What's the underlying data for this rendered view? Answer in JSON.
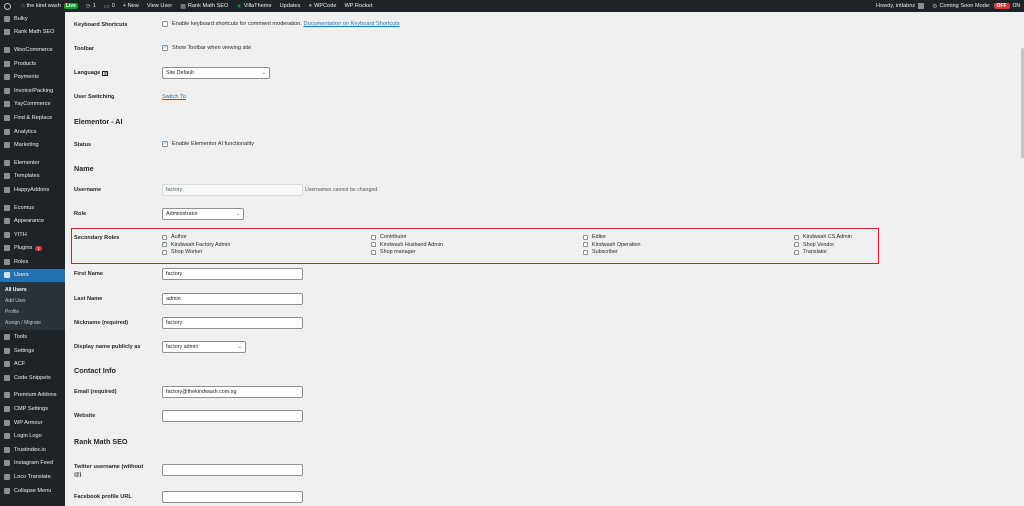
{
  "adminbar": {
    "site_name": "the kind wash",
    "live_label": "Live",
    "updates_count": "1",
    "comments_count": "0",
    "new_label": "+ New",
    "view_user_label": "View User",
    "items": [
      "Rank Math SEO",
      "VillaTheme",
      "Updates",
      "WPCode",
      "WP Rocket"
    ],
    "howdy": "Howdy, intlabnz",
    "coming_soon_label": "Coming Soon Mode:",
    "off_label": "OFF",
    "on_label": "ON"
  },
  "sidebar": {
    "items": [
      {
        "label": "Bulky",
        "icon": "bulky-icon"
      },
      {
        "label": "Rank Math SEO",
        "icon": "rank-math-icon"
      },
      {
        "label": "WooCommerce",
        "icon": "woocommerce-icon"
      },
      {
        "label": "Products",
        "icon": "products-icon"
      },
      {
        "label": "Payments",
        "icon": "payments-icon"
      },
      {
        "label": "Invoice/Packing",
        "icon": "invoice-icon"
      },
      {
        "label": "YayCommerce",
        "icon": "yaycommerce-icon"
      },
      {
        "label": "Find & Replace",
        "icon": "find-replace-icon"
      },
      {
        "label": "Analytics",
        "icon": "analytics-icon"
      },
      {
        "label": "Marketing",
        "icon": "marketing-icon"
      },
      {
        "label": "Elementor",
        "icon": "elementor-icon"
      },
      {
        "label": "Templates",
        "icon": "templates-icon"
      },
      {
        "label": "HappyAddons",
        "icon": "happyaddons-icon"
      },
      {
        "label": "Ecomus",
        "icon": "ecomus-icon"
      },
      {
        "label": "Appearance",
        "icon": "appearance-icon"
      },
      {
        "label": "YITH",
        "icon": "yith-icon"
      },
      {
        "label": "Plugins",
        "icon": "plugins-icon",
        "badge": "1"
      },
      {
        "label": "Roles",
        "icon": "roles-icon"
      },
      {
        "label": "Users",
        "icon": "users-icon"
      }
    ],
    "submenu": [
      "All Users",
      "Add User",
      "Profile",
      "Assign / Migrate"
    ],
    "items_after": [
      {
        "label": "Tools",
        "icon": "tools-icon"
      },
      {
        "label": "Settings",
        "icon": "settings-icon"
      },
      {
        "label": "ACF",
        "icon": "acf-icon"
      },
      {
        "label": "Code Snippets",
        "icon": "code-snippets-icon"
      },
      {
        "label": "Premium Addons",
        "icon": "premium-addons-icon"
      },
      {
        "label": "CMP Settings",
        "icon": "cmp-icon"
      },
      {
        "label": "WP Armour",
        "icon": "wp-armour-icon"
      },
      {
        "label": "Login Logo",
        "icon": "login-logo-icon"
      },
      {
        "label": "Trustindex.io",
        "icon": "trustindex-icon"
      },
      {
        "label": "Instagram Feed",
        "icon": "instagram-icon"
      },
      {
        "label": "Loco Translate",
        "icon": "loco-icon"
      },
      {
        "label": "Collapse Menu",
        "icon": "collapse-icon"
      }
    ]
  },
  "form": {
    "keyboard_label": "Keyboard Shortcuts",
    "keyboard_text": "Enable keyboard shortcuts for comment moderation.",
    "keyboard_link": "Documentation on Keyboard Shortcuts",
    "toolbar_label": "Toolbar",
    "toolbar_text": "Show Toolbar when viewing site",
    "language_label": "Language",
    "language_value": "Site Default",
    "user_switching_label": "User Switching",
    "switch_to": "Switch To",
    "elementor_ai_heading": "Elementor - AI",
    "status_label": "Status",
    "status_text": "Enable Elementor AI functionality",
    "name_heading": "Name",
    "username_label": "Username",
    "username_value": "factory",
    "username_desc": "Usernames cannot be changed.",
    "role_label": "Role",
    "role_value": "Administrator",
    "secondary_roles_label": "Secondary Roles",
    "secondary_roles": [
      {
        "label": "Author",
        "checked": false
      },
      {
        "label": "Kindwash Factory Admin",
        "checked": true
      },
      {
        "label": "Shop Worker",
        "checked": false
      },
      {
        "label": "Contributor",
        "checked": false
      },
      {
        "label": "Kindwash Husband Admin",
        "checked": false
      },
      {
        "label": "Shop manager",
        "checked": false
      },
      {
        "label": "Editor",
        "checked": false
      },
      {
        "label": "Kindwash Operation",
        "checked": false
      },
      {
        "label": "Subscriber",
        "checked": false
      },
      {
        "label": "Kindwash CS Admin",
        "checked": false
      },
      {
        "label": "Shop Vendor",
        "checked": false
      },
      {
        "label": "Translator",
        "checked": false
      }
    ],
    "first_name_label": "First Name",
    "first_name_value": "factory",
    "last_name_label": "Last Name",
    "last_name_value": "admin",
    "nickname_label": "Nickname (required)",
    "nickname_value": "factory",
    "display_name_label": "Display name publicly as",
    "display_name_value": "factory admin",
    "contact_heading": "Contact Info",
    "email_label": "Email (required)",
    "email_value": "factory@thekindwash.com.sg",
    "website_label": "Website",
    "website_value": "",
    "rank_math_heading": "Rank Math SEO",
    "twitter_label_1": "Twitter username (without",
    "twitter_label_2": "@)",
    "twitter_value": "",
    "facebook_label": "Facebook profile URL",
    "facebook_value": ""
  },
  "colors": {
    "accent": "#2271b1",
    "admin_bg": "#1d2327",
    "highlight_border": "#d41e23",
    "off_badge": "#d63638",
    "live_badge": "#00a32a"
  }
}
